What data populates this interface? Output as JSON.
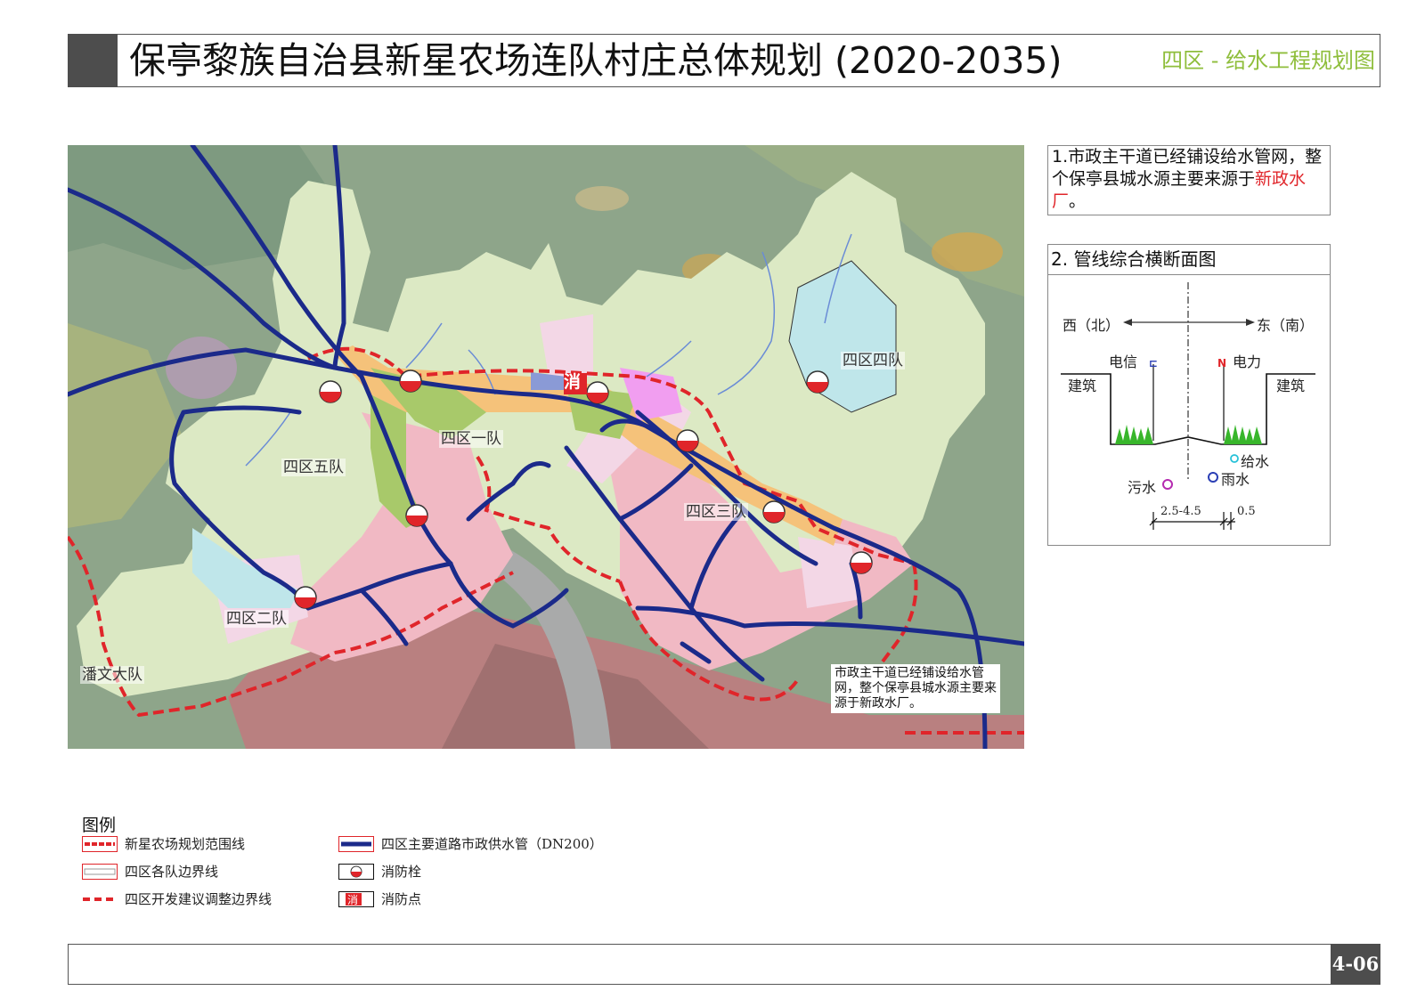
{
  "header": {
    "title": "保亭黎族自治县新星农场连队村庄总体规划 (2020-2035)",
    "sheet_title": "四区 - 给水工程规划图"
  },
  "map": {
    "labels": {
      "team1": "四区一队",
      "team2": "四区二队",
      "team3": "四区三队",
      "team4": "四区四队",
      "team5": "四区五队",
      "panwen": "潘文大队",
      "fire_point": "消"
    },
    "note": "市政主干道已经铺设给水管网，整个保亭县城水源主要来源于新政水厂。",
    "colors": {
      "water_main": "#1b2a8a",
      "plan_boundary": "#e0252a",
      "village_land": "#dce9c4",
      "background_forest": "#8ea58a",
      "residential_pink": "#f1b9c4",
      "urban_red": "#b98080",
      "river": "#a9aaaa"
    }
  },
  "notes": {
    "note1_prefix": "1.市政主干道已经铺设给水管网，整个保亭县城水源主要来源于",
    "note1_highlight": "新政水厂",
    "note1_suffix": "。"
  },
  "cross_section": {
    "title": "2. 管线综合横断面图",
    "west": "西（北）",
    "east": "东（南）",
    "telecom": "电信",
    "power": "电力",
    "building_left": "建筑",
    "building_right": "建筑",
    "water_supply": "给水",
    "rain": "雨水",
    "sewage": "污水",
    "dim1": "2.5-4.5",
    "dim2": "0.5"
  },
  "legend": {
    "title": "图例",
    "items": [
      {
        "label": "新星农场规划范围线"
      },
      {
        "label": "四区各队边界线"
      },
      {
        "label": "四区开发建议调整边界线"
      },
      {
        "label": "四区主要道路市政供水管（DN200）"
      },
      {
        "label": "消防栓"
      },
      {
        "label": "消防点"
      }
    ]
  },
  "footer": {
    "page_number": "4-06"
  }
}
